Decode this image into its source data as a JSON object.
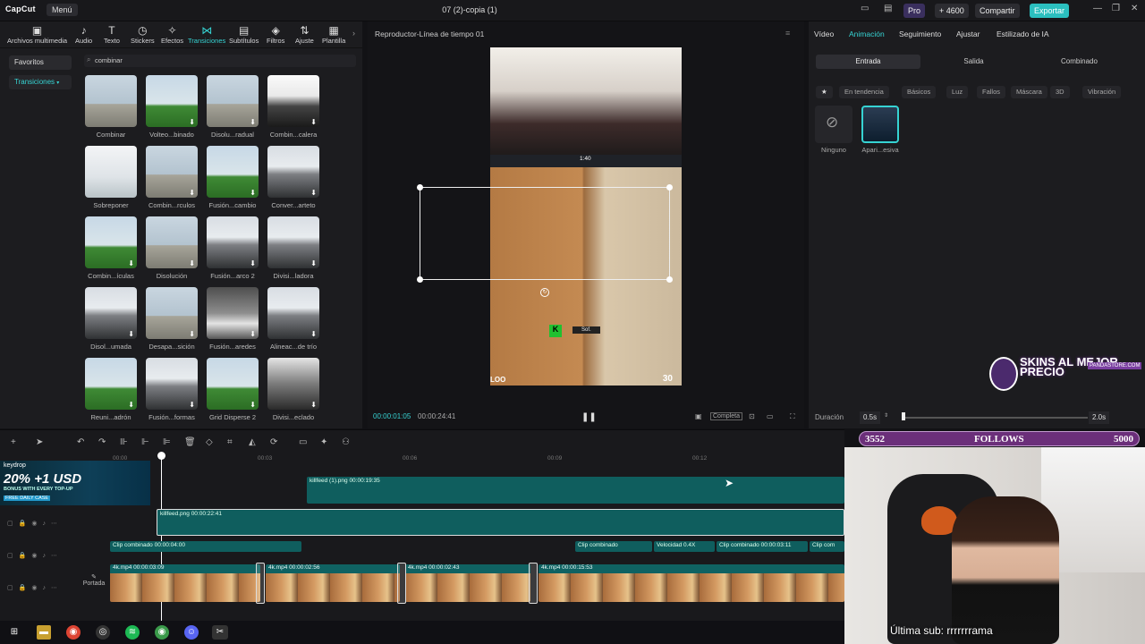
{
  "app": {
    "logo": "CapCut",
    "menu": "Menú",
    "title": "07 (2)-copia (1)",
    "pro": "Pro",
    "credits": "+ 4600",
    "share": "Compartir",
    "export": "Exportar"
  },
  "toolbar": [
    {
      "label": "Archivos multimedia",
      "icon": "▣"
    },
    {
      "label": "Audio",
      "icon": "♪"
    },
    {
      "label": "Texto",
      "icon": "T"
    },
    {
      "label": "Stickers",
      "icon": "◷"
    },
    {
      "label": "Efectos",
      "icon": "✧"
    },
    {
      "label": "Transiciones",
      "icon": "⋈"
    },
    {
      "label": "Subtítulos",
      "icon": "▤"
    },
    {
      "label": "Filtros",
      "icon": "◈"
    },
    {
      "label": "Ajuste",
      "icon": "⇅"
    },
    {
      "label": "Plantilla",
      "icon": "▦"
    }
  ],
  "sidenav": {
    "favorites": "Favoritos",
    "transitions": "Transiciones"
  },
  "search": {
    "value": "combinar"
  },
  "transitions": [
    {
      "label": "Combinar",
      "style": "t-tower"
    },
    {
      "label": "Volteo...binado",
      "style": "t-grass"
    },
    {
      "label": "Disolu...radual",
      "style": "t-tower"
    },
    {
      "label": "Combin...calera",
      "style": "t-city"
    },
    {
      "label": "Sobreponer",
      "style": "t-soft"
    },
    {
      "label": "Combin...rculos",
      "style": "t-tower"
    },
    {
      "label": "Fusión...cambio",
      "style": "t-grass"
    },
    {
      "label": "Conver...arteto",
      "style": "t-mount"
    },
    {
      "label": "Combin...ículas",
      "style": "t-grass"
    },
    {
      "label": "Disolución",
      "style": "t-tower"
    },
    {
      "label": "Fusión...arco 2",
      "style": "t-mount"
    },
    {
      "label": "Divisi...ladora",
      "style": "t-mount"
    },
    {
      "label": "Disol...umada",
      "style": "t-mount"
    },
    {
      "label": "Desapa...sición",
      "style": "t-tower"
    },
    {
      "label": "Fusión...aredes",
      "style": "t-windm"
    },
    {
      "label": "Alineac...de trío",
      "style": "t-mount"
    },
    {
      "label": "Reuni...adrón",
      "style": "t-grass"
    },
    {
      "label": "Fusión...formas",
      "style": "t-mount"
    },
    {
      "label": "Grid Disperse 2",
      "style": "t-grass"
    },
    {
      "label": "Divisi...eclado",
      "style": "t-dark"
    }
  ],
  "player": {
    "title": "Reproductor-Línea de tiempo 01",
    "current": "00:00:01:05",
    "total": "00:00:24:41",
    "mode": "Completa",
    "hud_time": "1:40",
    "score": "30",
    "score_left": "LOO",
    "team_tag": "Sof."
  },
  "right": {
    "tabs": [
      "Vídeo",
      "Animación",
      "Seguimiento",
      "Ajustar",
      "Estilizado de IA"
    ],
    "subtabs": [
      "Entrada",
      "Salida",
      "Combinado"
    ],
    "chips": [
      "En tendencia",
      "Básicos",
      "Luz",
      "Fallos",
      "Máscara",
      "3D",
      "Vibración"
    ],
    "none_label": "Ninguno",
    "selected_label": "Apari...esiva",
    "duration_label": "Duración",
    "duration_value": "0.5s",
    "duration_max": "2.0s"
  },
  "timeline": {
    "ruler": [
      "00:00",
      "00:03",
      "00:06",
      "00:09",
      "00:12"
    ],
    "tracks": [
      {
        "label": "killfeed (1).png  00:00:19:35"
      },
      {
        "label": "killfeed.png  00:00:22:41"
      },
      {
        "label": "Clip combinado  00:00:04:00"
      },
      {
        "label": "Clip combinado"
      },
      {
        "label": "Velocidad 0.4X"
      },
      {
        "label": "Clip combinado  00:00:03:11"
      },
      {
        "label": "Clip com"
      }
    ],
    "clips": [
      {
        "label": "4k.mp4  00:00:03:09"
      },
      {
        "label": "4k.mp4  00:00:02:56"
      },
      {
        "label": "4k.mp4  00:00:02:43"
      },
      {
        "label": "4k.mp4  00:00:15:53"
      }
    ],
    "cover_label": "Portada"
  },
  "overlay": {
    "follows_current": "3552",
    "follows_label": "FOLLOWS",
    "follows_goal": "5000",
    "last_sub": "Última sub: rrrrrrrama",
    "promo_big": "SKINS AL MEJOR PRECIO",
    "promo_site": "PANDASTORE.COM",
    "keydrop_brand": "keydrop",
    "keydrop_offer": "20% +1 USD",
    "keydrop_bonus": "BONUS WITH EVERY TOP-UP",
    "keydrop_case": "FREE DAILY CASE"
  },
  "colors": {
    "accent": "#36d3d3",
    "track": "#0f5e5e",
    "follows": "#6b2f7a",
    "export": "#2bbfbf"
  }
}
